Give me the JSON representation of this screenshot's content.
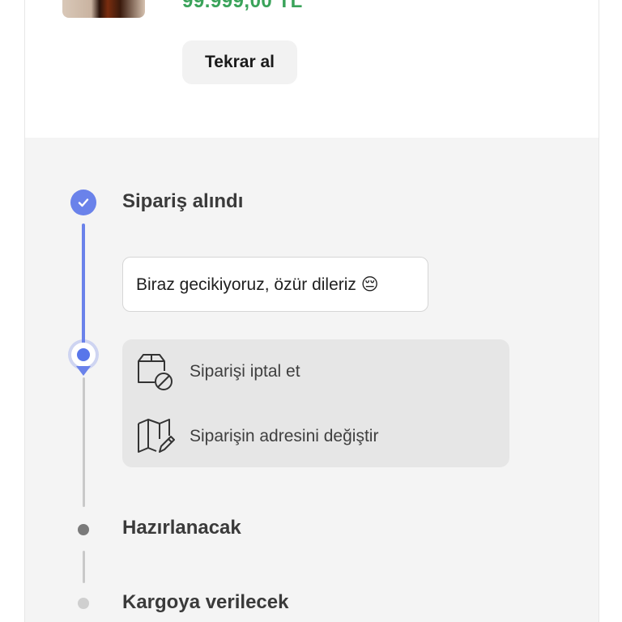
{
  "product": {
    "price": "99.999,00 TL",
    "reorder_label": "Tekrar al"
  },
  "timeline": {
    "steps": [
      {
        "title": "Sipariş alındı",
        "state": "done"
      },
      {
        "title": "Hazırlanacak",
        "state": "pending"
      },
      {
        "title": "Kargoya verilecek",
        "state": "pending"
      }
    ],
    "delay_message": "Biraz gecikiyoruz, özür dileriz 😔",
    "actions": [
      {
        "label": "Siparişi iptal et",
        "icon": "package-cancel-icon"
      },
      {
        "label": "Siparişin adresini değiştir",
        "icon": "map-edit-icon"
      }
    ]
  },
  "colors": {
    "accent": "#6a82ea",
    "price": "#3aa35a",
    "panel_bg": "#f4f4f4",
    "action_bg": "#e6e6e6"
  }
}
